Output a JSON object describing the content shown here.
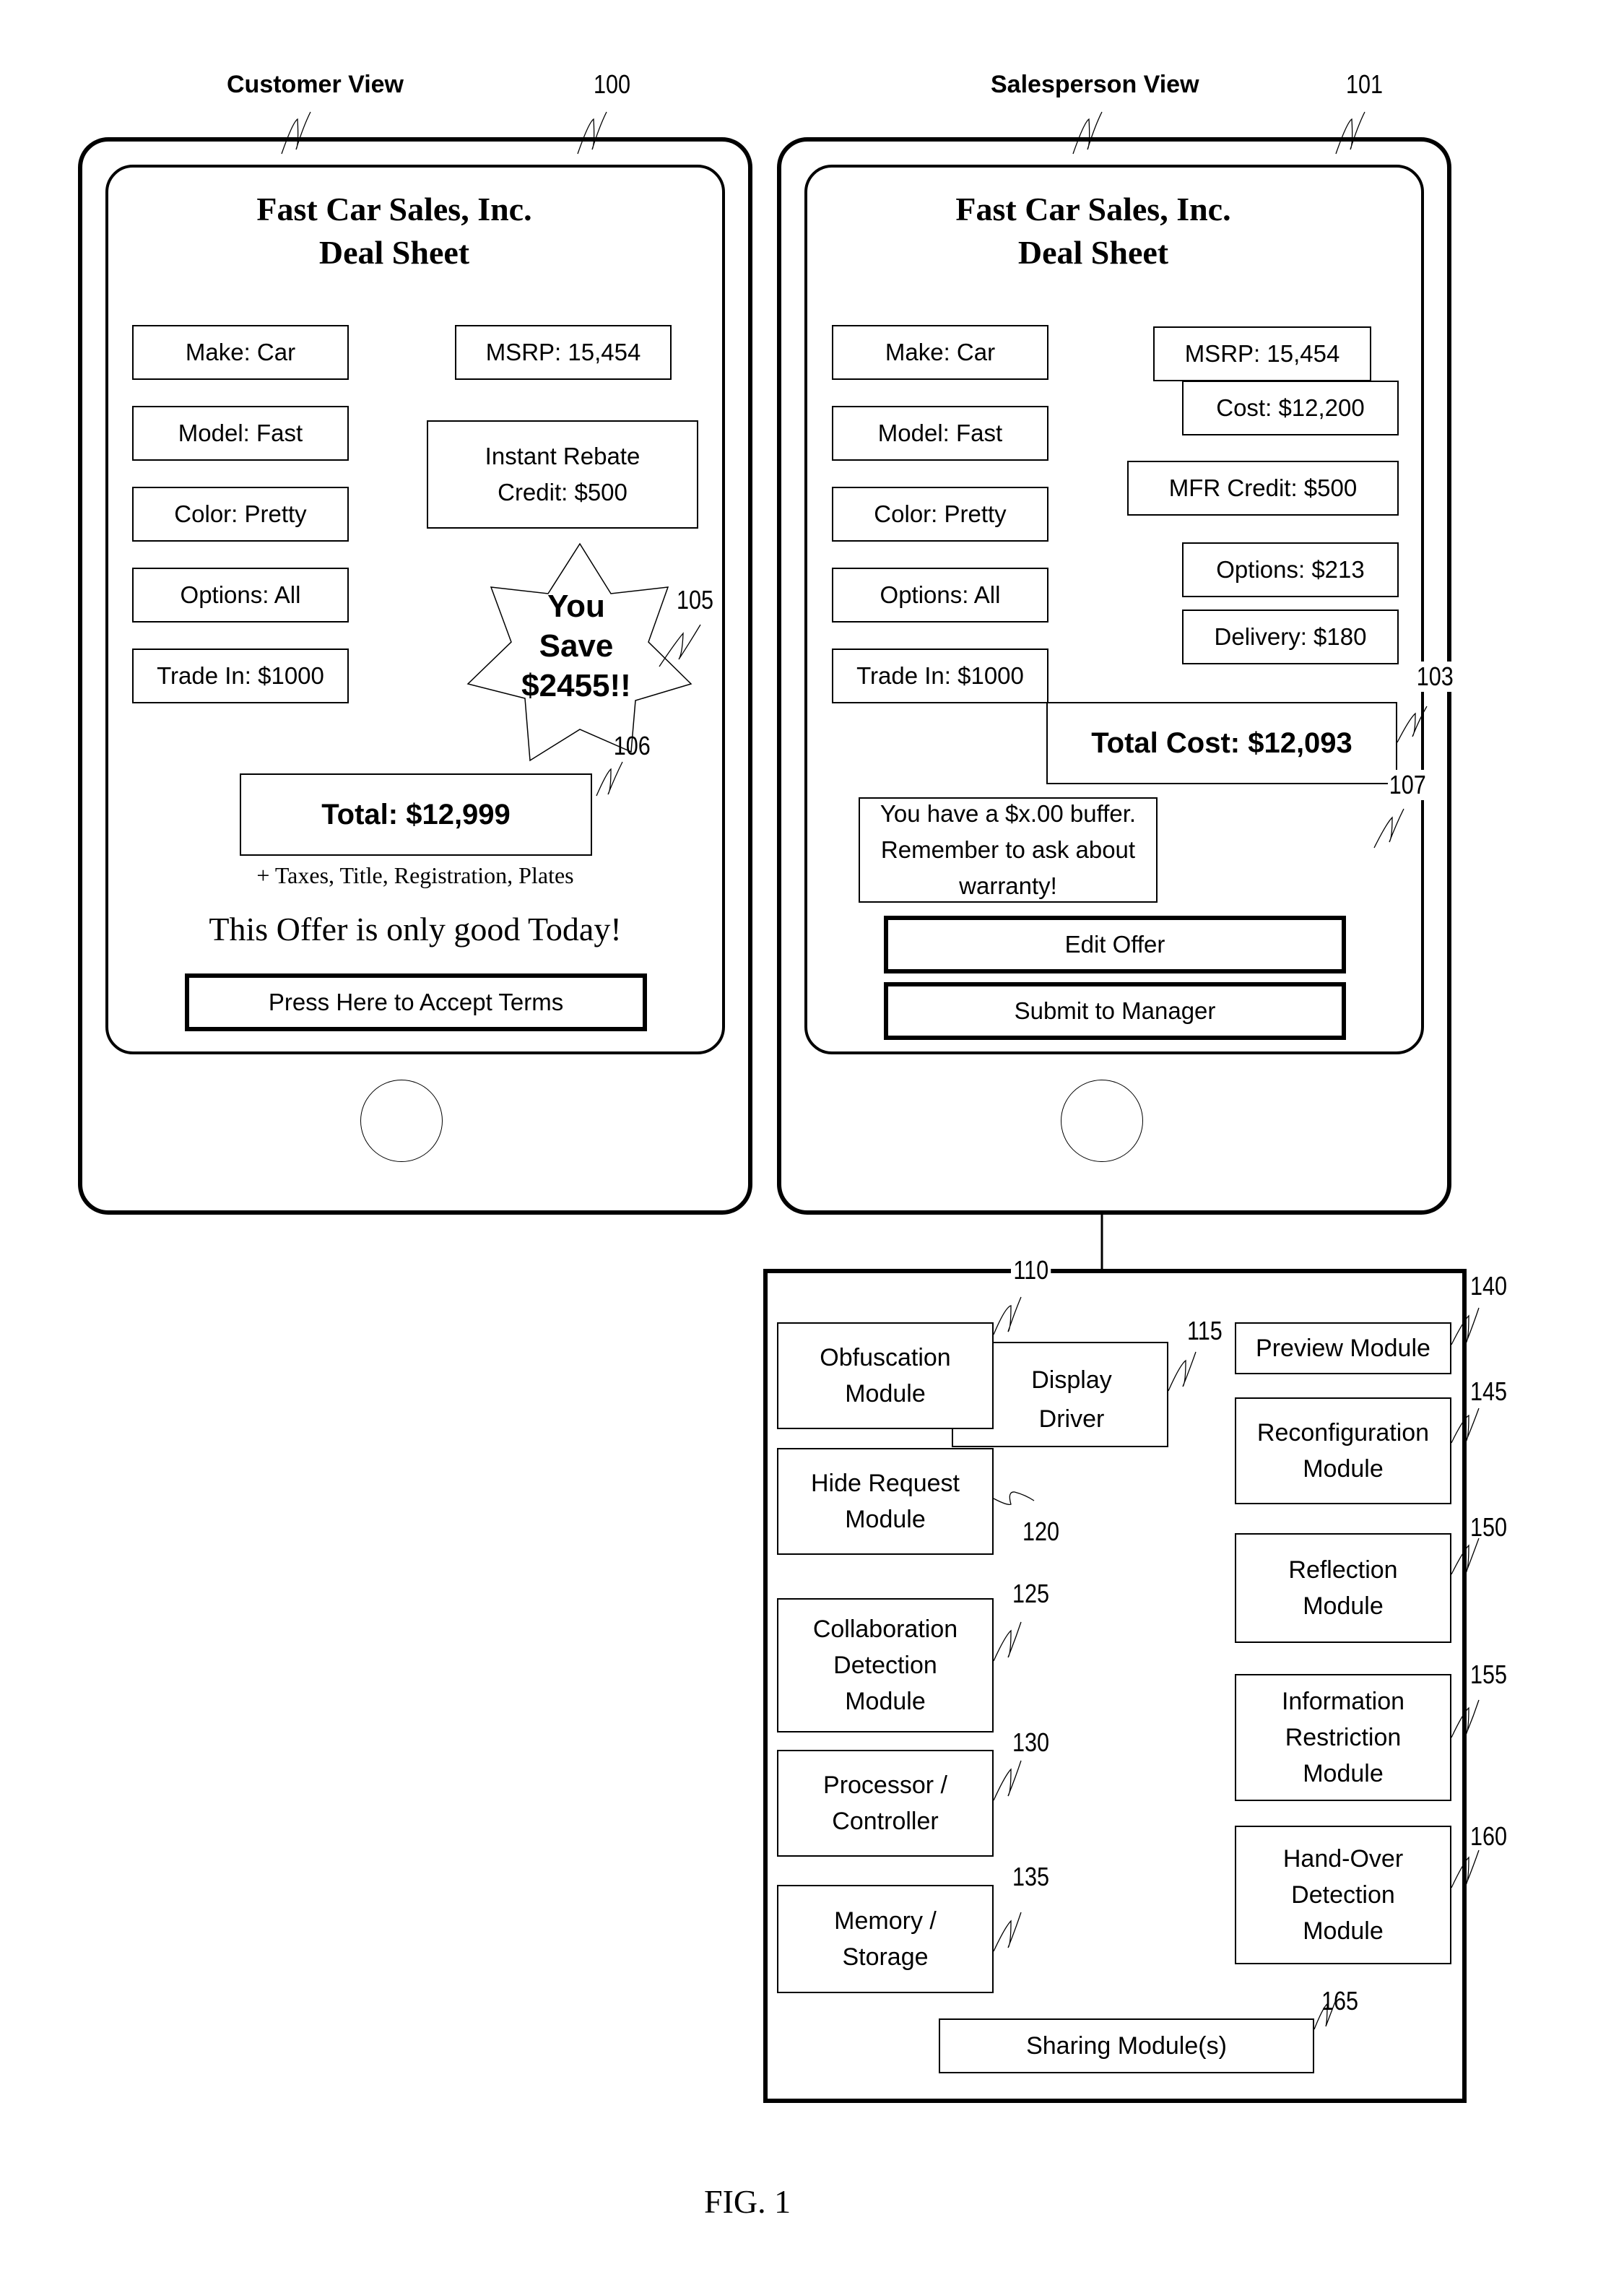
{
  "figure_label": "FIG. 1",
  "customer_view": {
    "label": "Customer View",
    "ref": "100",
    "title_line1": "Fast Car Sales, Inc.",
    "title_line2": "Deal Sheet",
    "fields": {
      "make": "Make: Car",
      "model": "Model: Fast",
      "color": "Color: Pretty",
      "options": "Options: All",
      "trade_in": "Trade In: $1000",
      "msrp": "MSRP: 15,454",
      "rebate_line1": "Instant Rebate",
      "rebate_line2": "Credit: $500"
    },
    "savings_burst": {
      "line1": "You",
      "line2": "Save",
      "line3": "$2455!!",
      "ref": "105"
    },
    "total": "Total: $12,999",
    "total_ref": "106",
    "fees_note": "+ Taxes, Title, Registration, Plates",
    "offer_note": "This Offer is only good Today!",
    "accept_button": "Press Here to Accept Terms"
  },
  "salesperson_view": {
    "label": "Salesperson View",
    "ref": "101",
    "title_line1": "Fast Car Sales, Inc.",
    "title_line2": "Deal Sheet",
    "fields": {
      "make": "Make: Car",
      "model": "Model: Fast",
      "color": "Color: Pretty",
      "options": "Options: All",
      "trade_in": "Trade In: $1000",
      "msrp": "MSRP: 15,454",
      "cost": "Cost: $12,200",
      "mfr_credit": "MFR Credit: $500",
      "options_cost": "Options: $213",
      "delivery": "Delivery: $180"
    },
    "total_cost": "Total Cost: $12,093",
    "total_cost_ref": "103",
    "buffer_note_line1": "You have a $x.00 buffer.",
    "buffer_note_line2": "Remember to ask about warranty!",
    "buffer_note_ref": "107",
    "edit_button": "Edit Offer",
    "submit_button": "Submit to Manager"
  },
  "system": {
    "ref": "110",
    "modules_left": [
      {
        "id": "obfuscation",
        "line1": "Obfuscation",
        "line2": "Module",
        "line3": ""
      },
      {
        "id": "hide-request",
        "line1": "Hide Request",
        "line2": "Module",
        "line3": "",
        "ref": "120"
      },
      {
        "id": "collaboration-detection",
        "line1": "Collaboration",
        "line2": "Detection",
        "line3": "Module",
        "ref": "125"
      },
      {
        "id": "processor",
        "line1": "Processor /",
        "line2": "Controller",
        "line3": "",
        "ref": "130"
      },
      {
        "id": "memory",
        "line1": "Memory /",
        "line2": "Storage",
        "line3": "",
        "ref": "135"
      }
    ],
    "display_driver": {
      "line1": "Display",
      "line2": "Driver",
      "ref": "115"
    },
    "modules_right": [
      {
        "id": "preview",
        "line1": "Preview Module",
        "line2": "",
        "line3": "",
        "ref": "140"
      },
      {
        "id": "reconfiguration",
        "line1": "Reconfiguration",
        "line2": "Module",
        "line3": "",
        "ref": "145"
      },
      {
        "id": "reflection",
        "line1": "Reflection",
        "line2": "Module",
        "line3": "",
        "ref": "150"
      },
      {
        "id": "information-restriction",
        "line1": "Information",
        "line2": "Restriction",
        "line3": "Module",
        "ref": "155"
      },
      {
        "id": "hand-over-detection",
        "line1": "Hand-Over",
        "line2": "Detection",
        "line3": "Module",
        "ref": "160"
      }
    ],
    "sharing": {
      "label": "Sharing Module(s)",
      "ref": "165"
    }
  }
}
